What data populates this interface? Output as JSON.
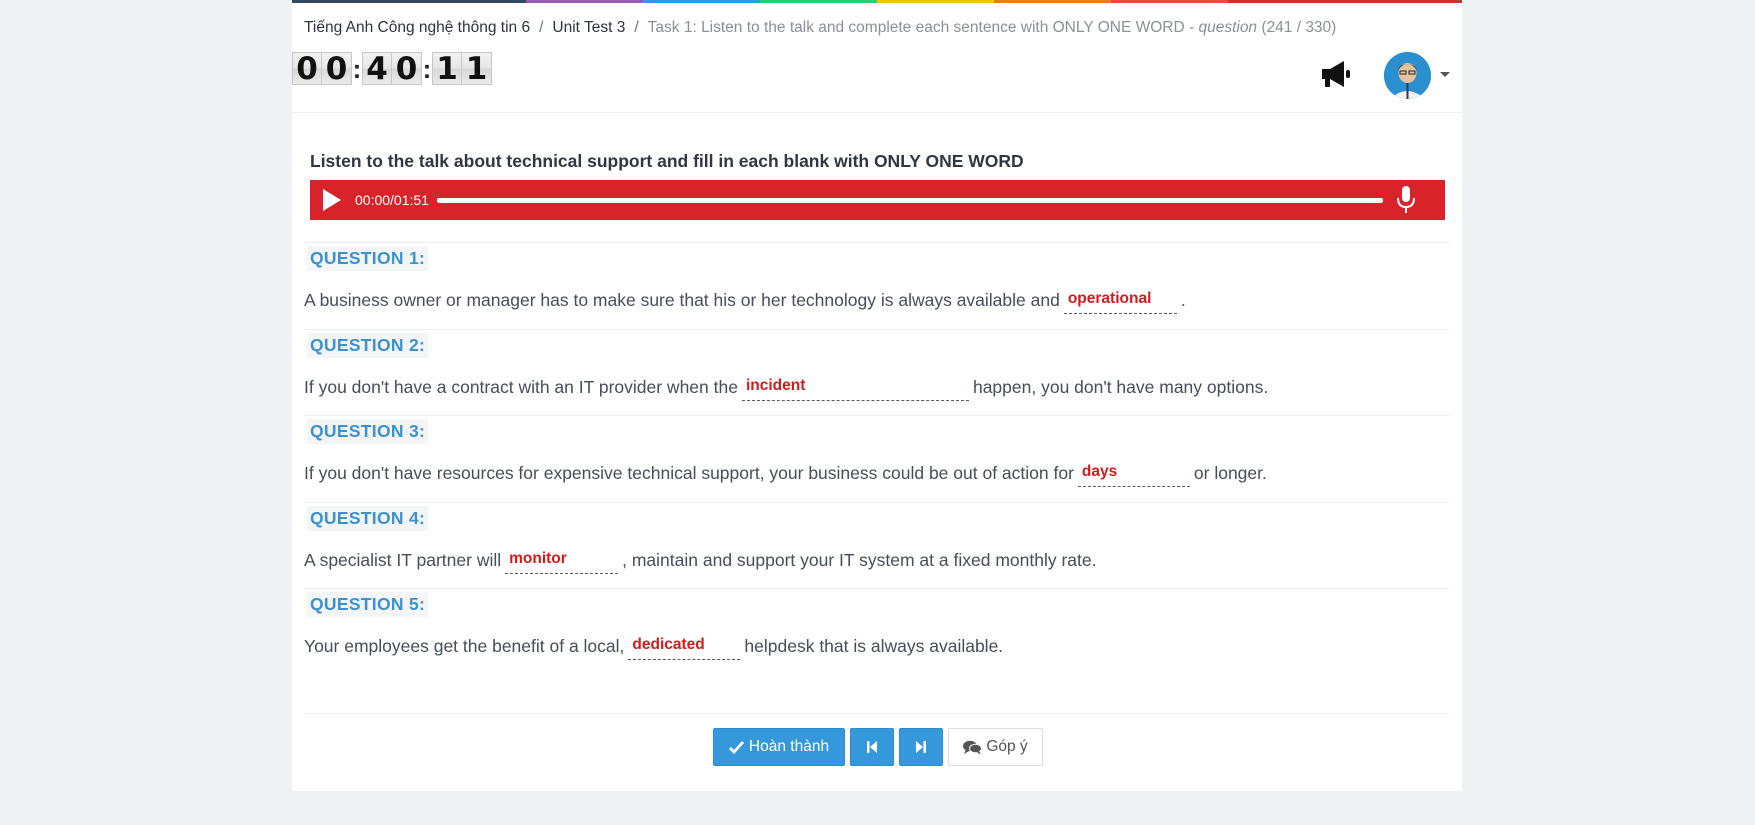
{
  "colors": {
    "bar": [
      "#34495e",
      "#34495e",
      "#9b59b6",
      "#3498db",
      "#2ecc71",
      "#f1c40f",
      "#e67e22",
      "#e74c3c",
      "#c0392b",
      "#c0392b"
    ],
    "accent": "#3498db",
    "audio_bar": "#d9232a",
    "answer": "#d61a1a",
    "question_label": "#3a92d2"
  },
  "breadcrumb": {
    "course": "Tiếng Anh Công nghệ thông tin 6",
    "unit": "Unit Test 3",
    "task": "Task 1: Listen to the talk and complete each sentence with ONLY ONE WORD -",
    "question_word": "question",
    "position": "(241 / 330)",
    "separator": "/"
  },
  "timer": {
    "hours": [
      "0",
      "0"
    ],
    "minutes": [
      "4",
      "0"
    ],
    "seconds": [
      "1",
      "1"
    ],
    "colon": ":"
  },
  "header": {
    "announce_icon": "megaphone-icon",
    "avatar_icon": "user-avatar",
    "menu_icon": "caret-down-icon"
  },
  "instruction": "Listen to the talk about technical support and fill in each blank with ONLY ONE WORD",
  "audio": {
    "time": "00:00/01:51",
    "progress": 0,
    "play_icon": "play-icon",
    "mic_icon": "microphone-icon"
  },
  "questions": [
    {
      "label": "QUESTION 1:",
      "before": "A business owner or manager has to make sure that his or her technology is always available and",
      "answer": "operational",
      "after": "."
    },
    {
      "label": "QUESTION 2:",
      "before": "If you don't have a contract with an IT provider when the",
      "answer": "incident",
      "after": "happen, you don't have many options."
    },
    {
      "label": "QUESTION 3:",
      "before": "If you don't have resources for expensive technical support, your business could be out of action for",
      "answer": "days",
      "after": "or longer."
    },
    {
      "label": "QUESTION 4:",
      "before": "A specialist IT partner will",
      "answer": "monitor",
      "after": ", maintain and support your IT system at a fixed monthly rate."
    },
    {
      "label": "QUESTION 5:",
      "before": "Your employees get the benefit of a local,",
      "answer": "dedicated",
      "after": "helpdesk that is always available."
    }
  ],
  "actions": {
    "finish_label": "Hoàn thành",
    "finish_icon": "check-icon",
    "prev_icon": "step-backward-icon",
    "next_icon": "step-forward-icon",
    "feedback_label": "Góp ý",
    "feedback_icon": "comments-icon"
  }
}
